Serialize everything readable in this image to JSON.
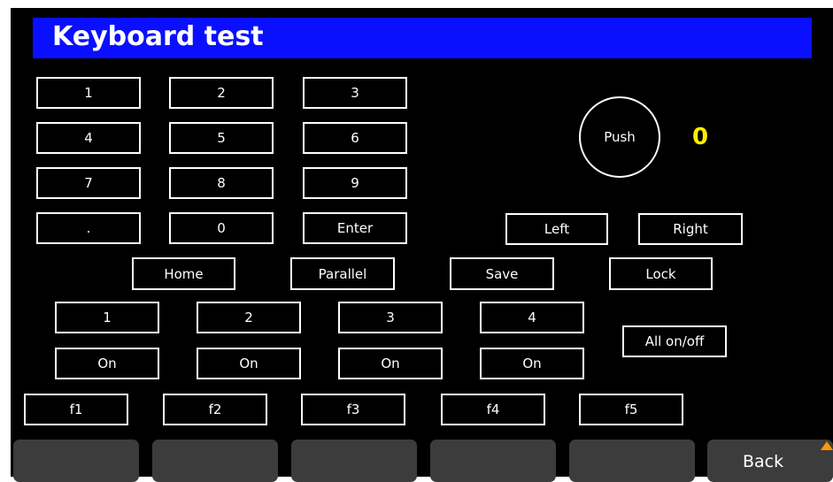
{
  "title": "Keyboard test",
  "keypad": [
    "1",
    "2",
    "3",
    "4",
    "5",
    "6",
    "7",
    "8",
    "9",
    ".",
    "0",
    "Enter"
  ],
  "knob": {
    "push_label": "Push",
    "count": "0",
    "count_color": "#ffee00"
  },
  "nav": {
    "left": "Left",
    "right": "Right"
  },
  "functions": {
    "home": "Home",
    "parallel": "Parallel",
    "save": "Save",
    "lock": "Lock"
  },
  "channels": [
    {
      "number": "1",
      "state": "On"
    },
    {
      "number": "2",
      "state": "On"
    },
    {
      "number": "3",
      "state": "On"
    },
    {
      "number": "4",
      "state": "On"
    }
  ],
  "all_on_off": "All on/off",
  "fkeys": [
    "f1",
    "f2",
    "f3",
    "f4",
    "f5"
  ],
  "softkeys": {
    "back": "Back"
  },
  "colors": {
    "title_bar": "#0a10ff",
    "softkey_bg": "#3c3c3c",
    "back_arrow": "#ff9900"
  },
  "icons": {
    "back_arrow": "triangle-up-icon"
  }
}
